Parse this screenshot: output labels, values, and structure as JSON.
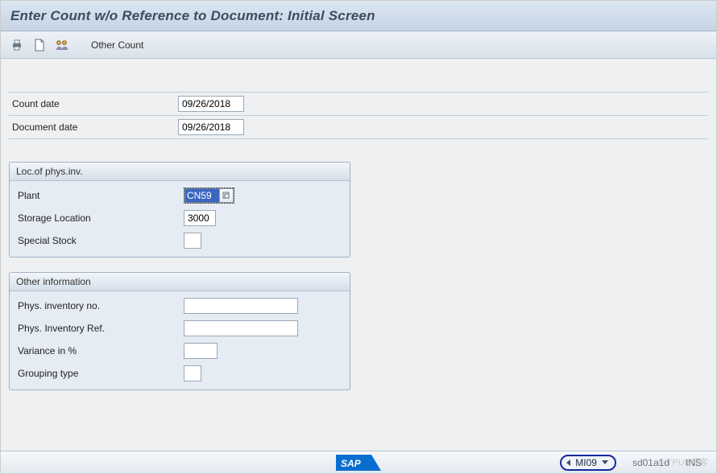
{
  "title": "Enter Count w/o Reference to Document: Initial Screen",
  "toolbar": {
    "other_count_label": "Other Count"
  },
  "dates": {
    "count_date_label": "Count date",
    "count_date_value": "09/26/2018",
    "document_date_label": "Document date",
    "document_date_value": "09/26/2018"
  },
  "loc_group": {
    "header": "Loc.of phys.inv.",
    "plant_label": "Plant",
    "plant_value": "CN59",
    "storage_loc_label": "Storage Location",
    "storage_loc_value": "3000",
    "special_stock_label": "Special Stock",
    "special_stock_value": ""
  },
  "other_group": {
    "header": "Other information",
    "phys_inv_no_label": "Phys. inventory no.",
    "phys_inv_no_value": "",
    "phys_inv_ref_label": "Phys. Inventory Ref.",
    "phys_inv_ref_value": "",
    "variance_label": "Variance in %",
    "variance_value": "",
    "grouping_type_label": "Grouping type",
    "grouping_type_value": ""
  },
  "statusbar": {
    "tcode": "MI09",
    "system": "sd01a1d",
    "ins": "INS"
  },
  "watermark": "©ITPUB博客"
}
